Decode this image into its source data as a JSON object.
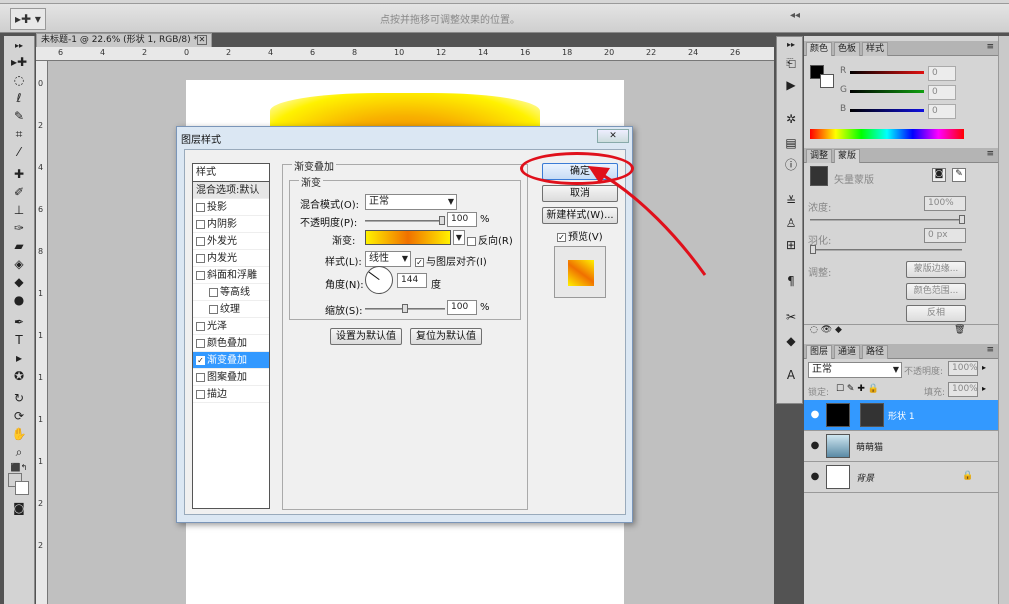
{
  "options_bar": {
    "tool_icon": "move-tool-icon",
    "tool_symbol": "▸✚ ▾",
    "hint": "点按并拖移可调整效果的位置。",
    "collapse_arrow": "◂◂"
  },
  "toolbox": {
    "collapse": "▸▸",
    "fg_color": "#000000",
    "bg_color": "#ffffff"
  },
  "document": {
    "tab_title": "未标题-1 @ 22.6% (形状 1, RGB/8) *",
    "close_symbol": "✕",
    "ruler_top_ticks": [
      "6",
      "4",
      "2",
      "0",
      "2",
      "4",
      "6",
      "8",
      "10",
      "12",
      "14",
      "16",
      "18",
      "20",
      "22",
      "24",
      "26"
    ],
    "ruler_left_ticks": [
      "0",
      "2",
      "4",
      "6",
      "8",
      "1",
      "1",
      "1",
      "1",
      "1",
      "2",
      "2"
    ]
  },
  "dialog": {
    "title": "图层样式",
    "close_symbol": "✕",
    "styles_header": "样式",
    "blend_options_item": "混合选项:默认",
    "style_items": [
      {
        "label": "投影",
        "checked": false,
        "sub": false
      },
      {
        "label": "内阴影",
        "checked": false,
        "sub": false
      },
      {
        "label": "外发光",
        "checked": false,
        "sub": false
      },
      {
        "label": "内发光",
        "checked": false,
        "sub": false
      },
      {
        "label": "斜面和浮雕",
        "checked": false,
        "sub": false
      },
      {
        "label": "等高线",
        "checked": false,
        "sub": true
      },
      {
        "label": "纹理",
        "checked": false,
        "sub": true
      },
      {
        "label": "光泽",
        "checked": false,
        "sub": false
      },
      {
        "label": "颜色叠加",
        "checked": false,
        "sub": false
      },
      {
        "label": "渐变叠加",
        "checked": true,
        "sub": false,
        "selected": true
      },
      {
        "label": "图案叠加",
        "checked": false,
        "sub": false
      },
      {
        "label": "描边",
        "checked": false,
        "sub": false
      }
    ],
    "group_title": "渐变叠加",
    "subgroup_title": "渐变",
    "blend_mode_label": "混合模式(O):",
    "blend_mode_value": "正常",
    "opacity_label": "不透明度(P):",
    "opacity_value": "100",
    "opacity_percent": 100,
    "percent": "%",
    "gradient_label": "渐变:",
    "reverse_label": "反向(R)",
    "reverse_checked": false,
    "style_label": "样式(L):",
    "style_value": "线性",
    "align_label": "与图层对齐(I)",
    "align_checked": true,
    "angle_label": "角度(N):",
    "angle_value": "144",
    "angle_unit": "度",
    "scale_label": "缩放(S):",
    "scale_value": "100",
    "scale_percent": 100,
    "set_default_btn": "设置为默认值",
    "reset_default_btn": "复位为默认值",
    "ok_btn": "确定",
    "cancel_btn": "取消",
    "new_style_btn": "新建样式(W)...",
    "preview_label": "预览(V)",
    "preview_checked": true,
    "gradient_colors": [
      "#fff200",
      "#f07000",
      "#fff200"
    ]
  },
  "annotation_color": "#e0101b",
  "icon_strip": {
    "collapse": "▸▸"
  },
  "color_panel": {
    "tabs": [
      "颜色",
      "色板",
      "样式"
    ],
    "channels": [
      {
        "label": "R",
        "value": "0",
        "color": "#e01010"
      },
      {
        "label": "G",
        "value": "0",
        "color": "#10a010"
      },
      {
        "label": "B",
        "value": "0",
        "color": "#1010e0"
      }
    ]
  },
  "masks_panel": {
    "tabs": [
      "调整",
      "蒙版"
    ],
    "title": "矢量蒙版",
    "density_label": "浓度:",
    "density_value": "100%",
    "feather_label": "羽化:",
    "feather_value": "0 px",
    "refine_label": "调整:",
    "mask_edge_btn": "蒙版边缘...",
    "color_range_btn": "颜色范围...",
    "invert_btn": "反相"
  },
  "layers_panel": {
    "tabs": [
      "图层",
      "通道",
      "路径"
    ],
    "blend_mode": "正常",
    "opacity_label": "不透明度:",
    "opacity_value": "100%",
    "lock_label": "锁定:",
    "fill_label": "填充:",
    "fill_value": "100%",
    "layers": [
      {
        "name": "形状 1",
        "selected": true
      },
      {
        "name": "萌萌猫",
        "selected": false
      },
      {
        "name": "背景",
        "selected": false,
        "locked": true
      }
    ]
  }
}
